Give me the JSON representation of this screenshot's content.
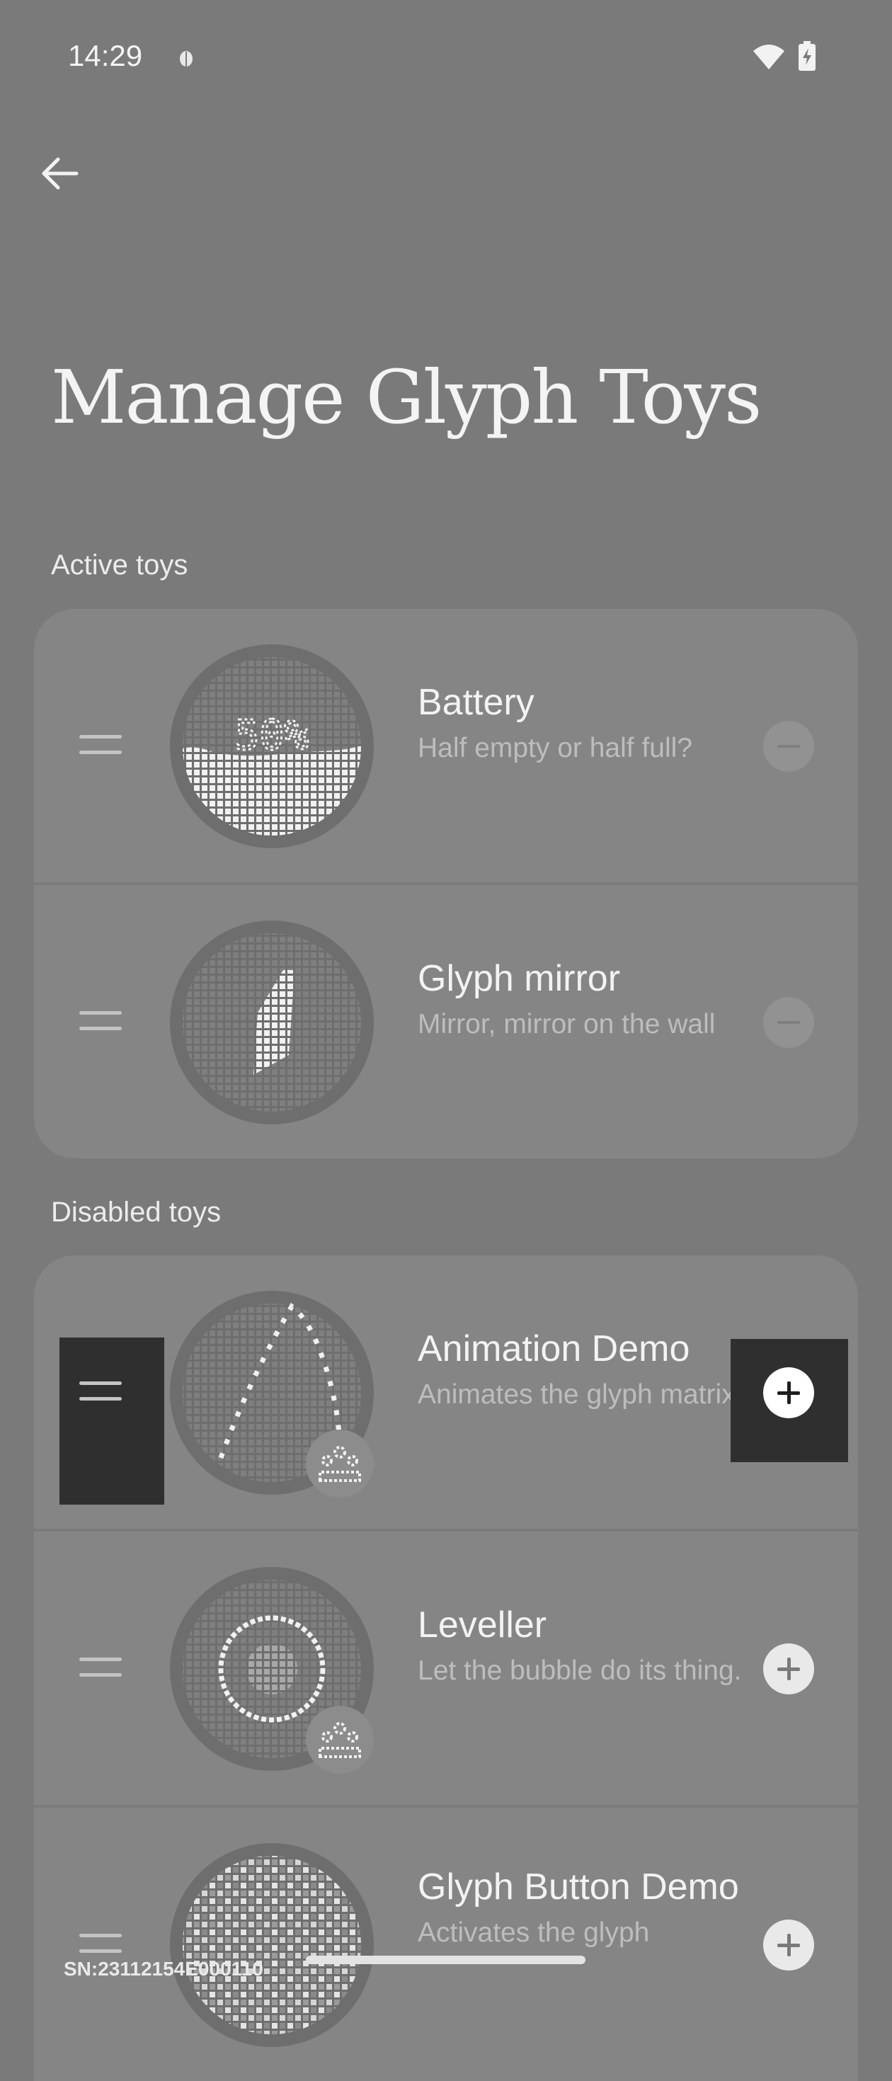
{
  "status_bar": {
    "time": "14:29",
    "icons": [
      "bug-icon",
      "wifi-icon",
      "battery-charging-icon"
    ]
  },
  "header": {
    "back_icon": "arrow-left-icon",
    "title": "Manage Glyph Toys"
  },
  "sections": {
    "active_label": "Active toys",
    "disabled_label": "Disabled toys"
  },
  "active_toys": [
    {
      "name": "Battery",
      "description": "Half empty or half full?",
      "action": "remove",
      "preview_text": "50%"
    },
    {
      "name": "Glyph mirror",
      "description": "Mirror, mirror on the wall",
      "action": "remove"
    }
  ],
  "disabled_toys": [
    {
      "name": "Animation Demo",
      "description": "Animates the glyph matrix.",
      "action": "add",
      "badge": "community-icon"
    },
    {
      "name": "Leveller",
      "description": "Let the bubble do its thing.",
      "action": "add",
      "badge": "community-icon"
    },
    {
      "name": "Glyph Button Demo",
      "description": "Activates the glyph",
      "action": "add"
    }
  ],
  "footer": {
    "serial": "SN:23112154E000110"
  },
  "colors": {
    "background": "#7a7a7a",
    "card": "#858585",
    "highlight": "#2f2f2f"
  }
}
